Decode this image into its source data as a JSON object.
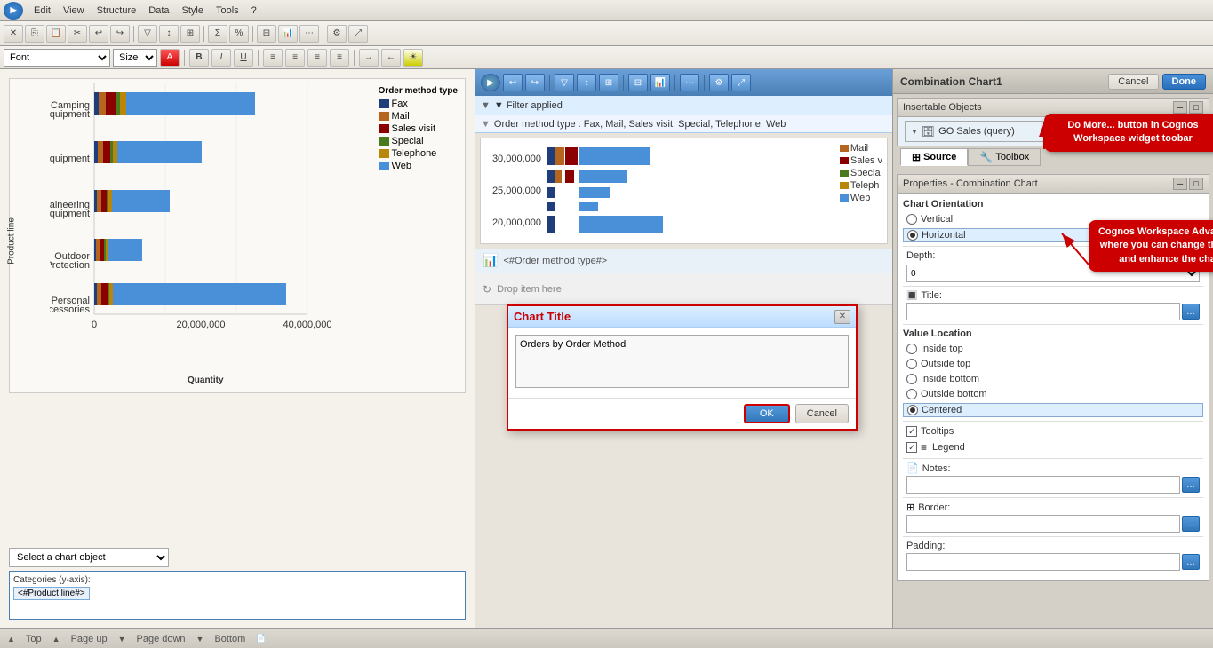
{
  "topbar": {
    "menus": [
      "Edit",
      "View",
      "Structure",
      "Data",
      "Style",
      "Tools",
      "?"
    ],
    "chart_name": "Combination Chart1",
    "cancel_label": "Cancel",
    "done_label": "Done"
  },
  "toolbar": {
    "font_label": "Font",
    "size_label": "Size",
    "font_default": "Font",
    "size_default": "Size"
  },
  "chart": {
    "title": "Orders by Order Method",
    "y_axis_label": "Product line",
    "x_axis_label": "Quantity",
    "legend_title": "Order method type",
    "legend_items": [
      {
        "label": "Fax",
        "color": "#1f3d7a"
      },
      {
        "label": "Mail",
        "color": "#b5651d"
      },
      {
        "label": "Sales visit",
        "color": "#8b0000"
      },
      {
        "label": "Special",
        "color": "#4a7a1e"
      },
      {
        "label": "Telephone",
        "color": "#b8860b"
      },
      {
        "label": "Web",
        "color": "#4a90d9"
      }
    ],
    "categories": [
      "Camping Equipment",
      "Golf Equipment",
      "Mountaineering Equipment",
      "Outdoor Protection",
      "Personal Accessories"
    ],
    "x_ticks": [
      "0",
      "20,000,000",
      "40,000,000"
    ]
  },
  "chart_select": {
    "placeholder": "Select a chart object",
    "category_label": "Categories (y-axis):",
    "category_value": "<#Product line#>"
  },
  "widget": {
    "filter_applied": "▼ Filter applied",
    "filter_detail": "Order method type : Fax, Mail, Sales visit, Special, Telephone, Web",
    "filter_icon": "▼",
    "order_method_label": "<#Order method type#>",
    "drop_label": "Drop item here"
  },
  "annotations": {
    "toolbar_annotation": "Do More... button in Cognos\nWorkspace  widget toobar",
    "canvas_annotation": "Cognos Workspace Advanced canvas\nwhere you can change the properties\nand enhance the chart/report"
  },
  "dialog": {
    "title": "Chart Title",
    "content": "Orders by Order Method",
    "ok_label": "OK",
    "cancel_label": "Cancel"
  },
  "right_panel": {
    "insertable_title": "Insertable Objects",
    "go_sales_label": "GO Sales (query)",
    "source_label": "Source",
    "toolbox_label": "Toolbox",
    "properties_title": "Properties - Combination Chart",
    "chart_orientation_label": "Chart Orientation",
    "vertical_label": "Vertical",
    "horizontal_label": "Horizontal",
    "depth_label": "Depth:",
    "depth_value": "0",
    "title_label": "Title:",
    "value_location_label": "Value Location",
    "inside_top": "Inside top",
    "outside_top": "Outside top",
    "inside_bottom": "Inside bottom",
    "outside_bottom": "Outside bottom",
    "centered": "Centered",
    "tooltips_label": "Tooltips",
    "legend_label": "Legend",
    "notes_label": "Notes:",
    "border_label": "Border:",
    "padding_label": "Padding:"
  },
  "status_bar": {
    "items": [
      "Top",
      "Page up",
      "Page down",
      "Bottom"
    ]
  },
  "preview_legend": {
    "items": [
      {
        "label": "Mail",
        "color": "#b5651d"
      },
      {
        "label": "Sales v",
        "color": "#8b0000"
      },
      {
        "label": "Specia",
        "color": "#4a7a1e"
      },
      {
        "label": "Teleph",
        "color": "#b8860b"
      },
      {
        "label": "Web",
        "color": "#4a90d9"
      }
    ]
  },
  "preview_yaxis": [
    "30,000,000",
    "25,000,000",
    "20,000,000"
  ]
}
